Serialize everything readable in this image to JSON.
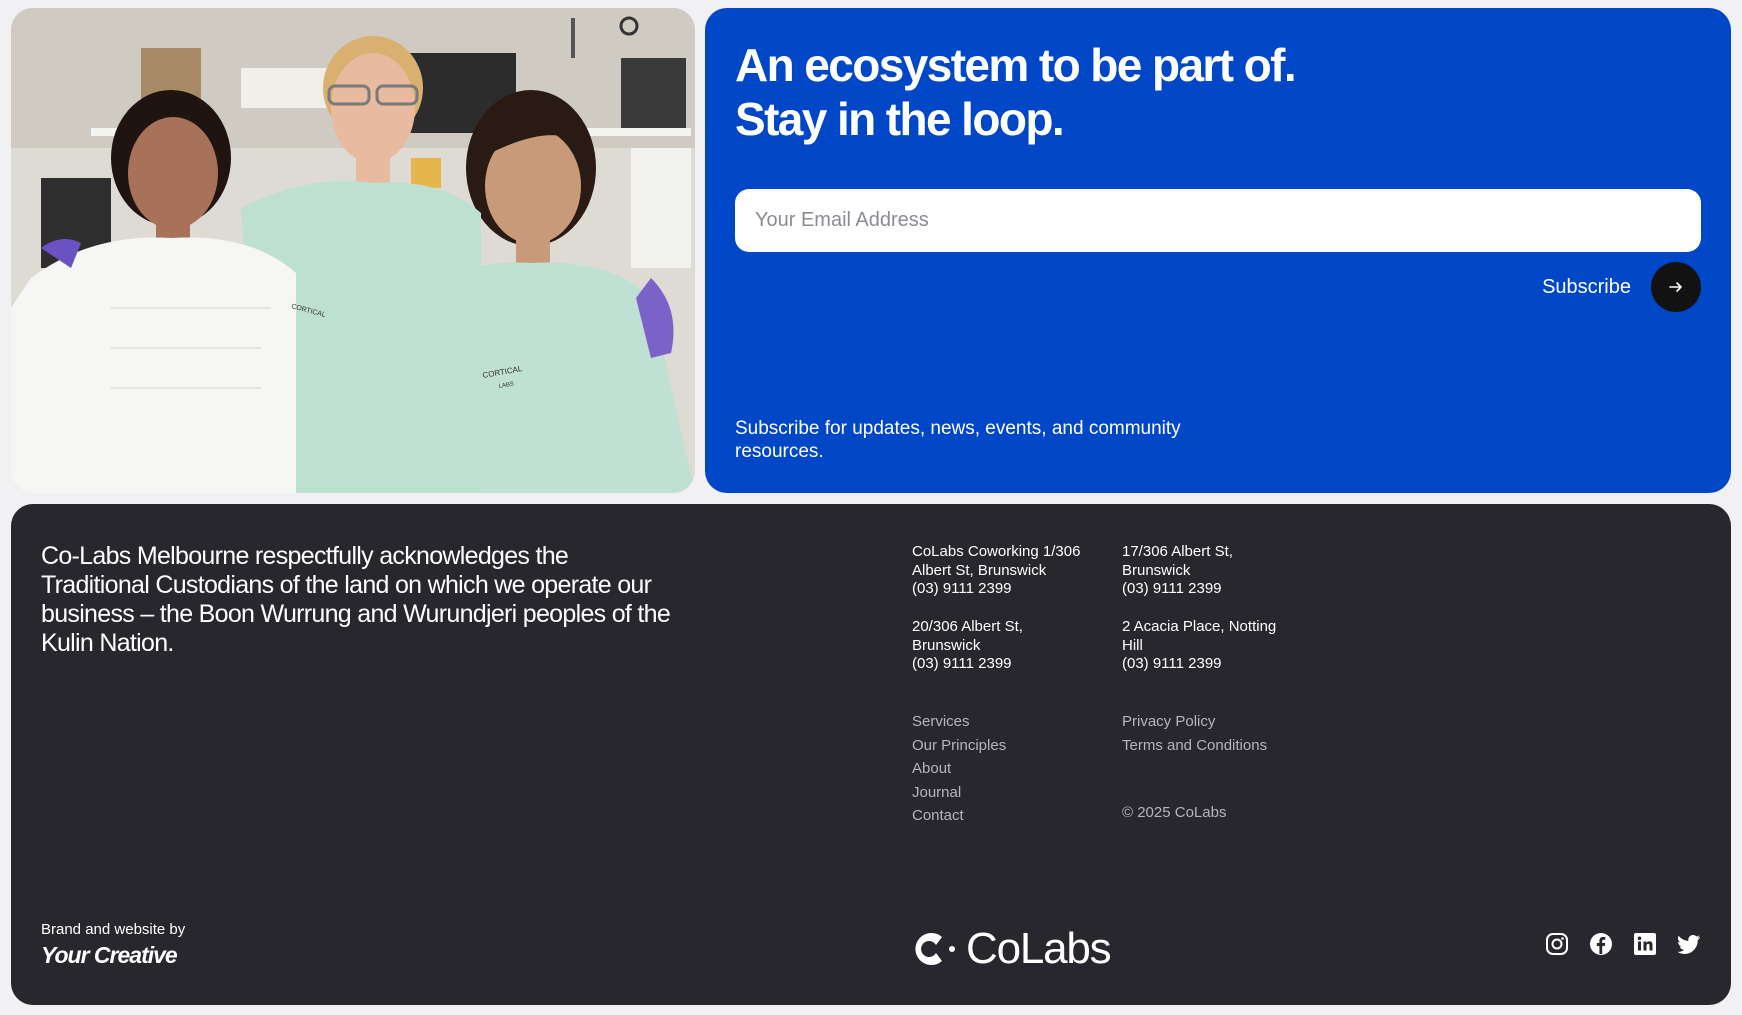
{
  "newsletter": {
    "headline_line1": "An ecosystem to be part of.",
    "headline_line2": "Stay in the loop.",
    "email_placeholder": "Your Email Address",
    "subscribe_label": "Subscribe",
    "blurb": "Subscribe for updates, news, events, and community resources.",
    "arrow_icon": "arrow-right-icon",
    "panel_color": "#0047C8"
  },
  "photo": {
    "print_left": "CORTICAL",
    "print_right_line1": "CORTICAL",
    "print_right_line2": "LABS"
  },
  "footer": {
    "acknowledgement": "Co-Labs Melbourne respectfully acknowledges the Traditional Custodians of the land on which we operate our business – the Boon Wurrung and Wurundjeri peoples of the Kulin Nation.",
    "addresses": [
      {
        "line1": "CoLabs Coworking 1/306",
        "line2": "Albert St, Brunswick",
        "phone": "(03) 9111 2399"
      },
      {
        "line1": "17/306 Albert St,",
        "line2": "Brunswick",
        "phone": "(03) 9111 2399"
      },
      {
        "line1": "20/306 Albert St,",
        "line2": "Brunswick",
        "phone": "(03) 9111 2399"
      },
      {
        "line1": "2 Acacia Place, Notting",
        "line2": "Hill",
        "phone": "(03) 9111 2399"
      }
    ],
    "nav_links": [
      "Services",
      "Our Principles",
      "About",
      "Journal",
      "Contact"
    ],
    "legal_links": [
      "Privacy Policy",
      "Terms and Conditions"
    ],
    "copyright": "© 2025 CoLabs",
    "credit_label": "Brand and website by",
    "credit_name": "Your Creative",
    "logo_text": "CoLabs",
    "social_icons": [
      "instagram-icon",
      "facebook-icon",
      "linkedin-icon",
      "twitter-icon"
    ],
    "background_color": "#27272D"
  }
}
